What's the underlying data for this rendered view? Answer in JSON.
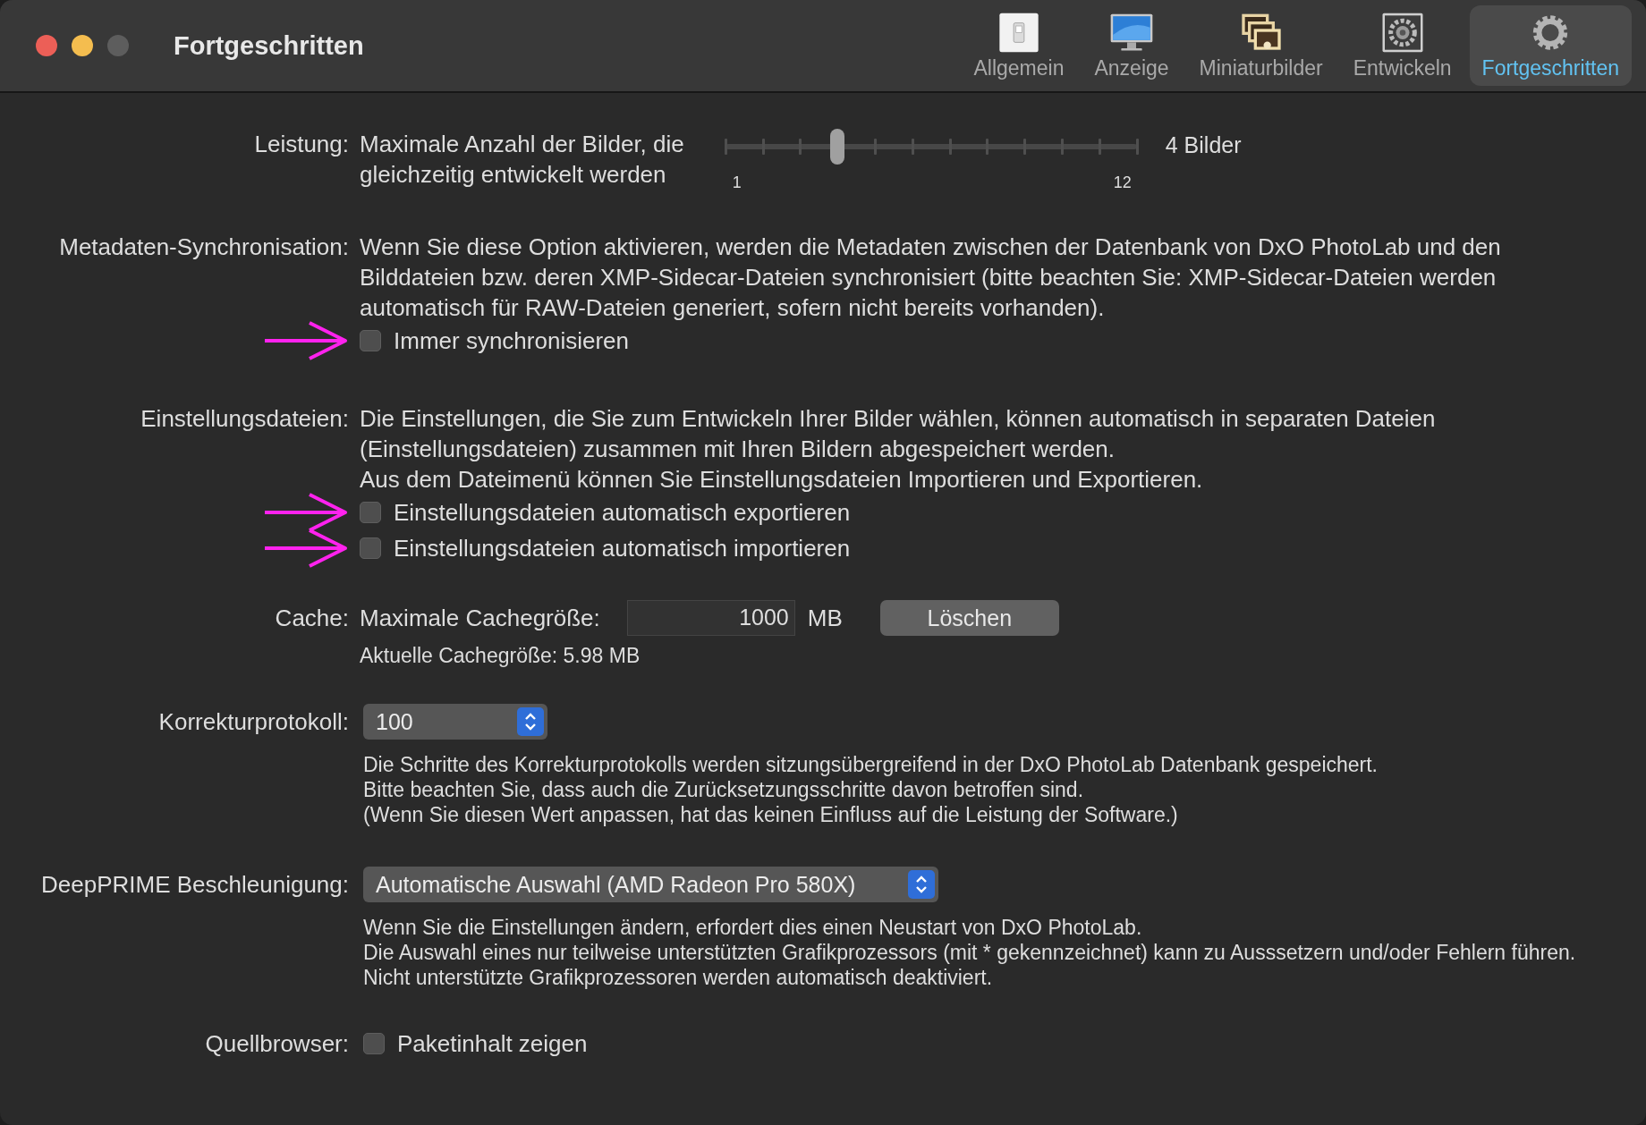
{
  "window": {
    "title": "Fortgeschritten"
  },
  "toolbar": [
    {
      "label": "Allgemein",
      "kind": "switch",
      "selected": false
    },
    {
      "label": "Anzeige",
      "kind": "monitor",
      "selected": false
    },
    {
      "label": "Miniaturbilder",
      "kind": "photos",
      "selected": false
    },
    {
      "label": "Entwickeln",
      "kind": "gear-panel",
      "selected": false
    },
    {
      "label": "Fortgeschritten",
      "kind": "gear",
      "selected": true
    }
  ],
  "performance": {
    "label": "Leistung:",
    "lines": [
      "Maximale Anzahl der Bilder, die",
      "gleichzeitig entwickelt werden"
    ],
    "level": 0.2727,
    "min_label": "1",
    "max_label": "12",
    "reading": "4 Bilder"
  },
  "metadata": {
    "label": "Metadaten-Synchronisation:",
    "lines": [
      "Wenn Sie diese Option aktivieren, werden die Metadaten zwischen der Datenbank von DxO PhotoLab und den",
      "Bilddateien bzw. deren XMP-Sidecar-Dateien synchronisiert (bitte beachten Sie: XMP-Sidecar-Dateien werden",
      "automatisch für RAW-Dateien generiert, sofern nicht bereits vorhanden)."
    ],
    "options": [
      {
        "label": "Immer synchronisieren",
        "checked": false,
        "arrow": true
      }
    ]
  },
  "settings_files": {
    "label": "Einstellungsdateien:",
    "lines": [
      "Die Einstellungen, die Sie zum Entwickeln Ihrer Bilder wählen, können automatisch in separaten Dateien",
      "(Einstellungsdateien) zusammen mit Ihren Bildern abgespeichert werden.",
      "Aus dem Dateimenü können Sie Einstellungsdateien Importieren und Exportieren."
    ],
    "options": [
      {
        "label": "Einstellungsdateien automatisch exportieren",
        "checked": false,
        "arrow": true
      },
      {
        "label": "Einstellungsdateien automatisch importieren",
        "checked": false,
        "arrow": true
      }
    ]
  },
  "cache": {
    "label": "Cache:",
    "field_label": "Maximale Cachegröße:",
    "value": "1000",
    "unit": "MB",
    "button": "Löschen",
    "current": "Aktuelle Cachegröße: 5.98 MB"
  },
  "history": {
    "label": "Korrekturprotokoll:",
    "value": "100",
    "notes": [
      "Die Schritte des Korrekturprotokolls werden sitzungsübergreifend in der DxO PhotoLab Datenbank gespeichert.",
      "Bitte beachten Sie, dass auch die Zurücksetzungsschritte davon betroffen sind.",
      "(Wenn Sie diesen Wert anpassen, hat das keinen Einfluss auf die Leistung der Software.)"
    ]
  },
  "deepprime": {
    "label": "DeepPRIME Beschleunigung:",
    "value": "Automatische Auswahl (AMD Radeon Pro 580X)",
    "notes": [
      "Wenn Sie die Einstellungen ändern, erfordert dies einen Neustart von DxO PhotoLab.",
      "Die Auswahl eines nur teilweise unterstützten Grafikprozessors (mit * gekennzeichnet) kann zu Ausssetzern und/oder Fehlern führen.",
      "Nicht unterstützte Grafikprozessoren werden automatisch deaktiviert."
    ]
  },
  "source_browser": {
    "label": "Quellbrowser:",
    "option": {
      "label": "Paketinhalt zeigen",
      "checked": false
    }
  }
}
